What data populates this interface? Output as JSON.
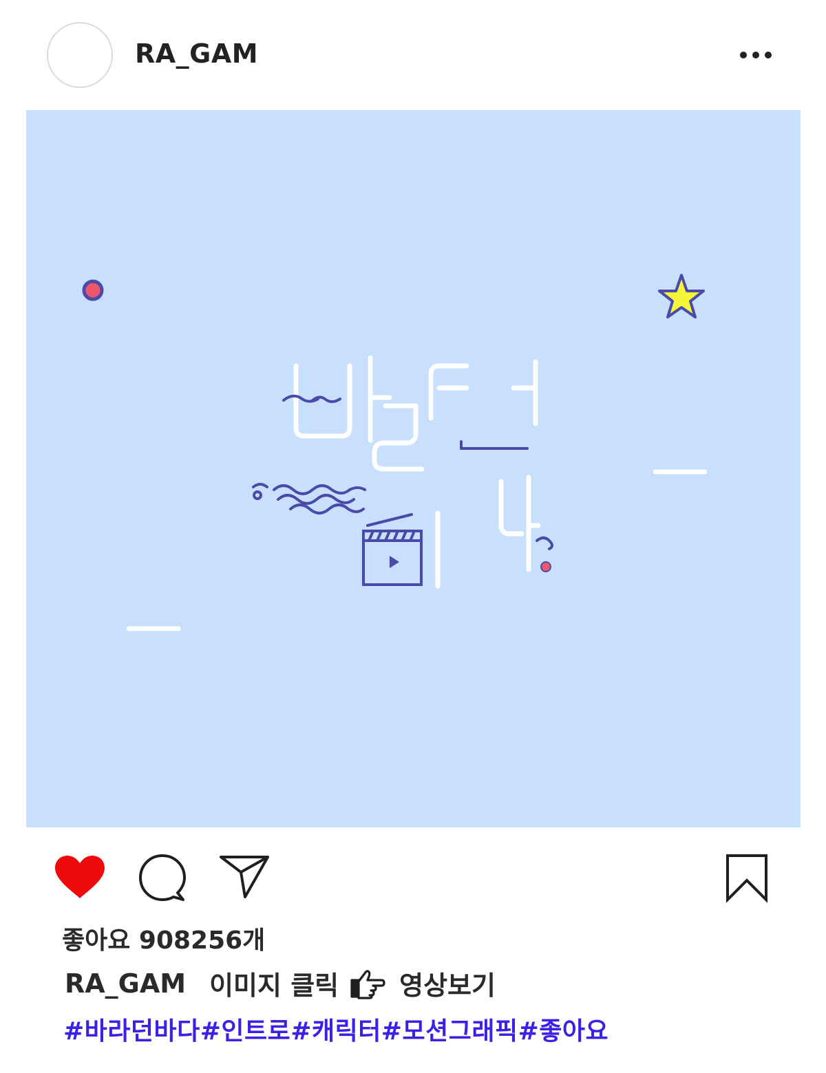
{
  "post": {
    "username": "RA_GAM",
    "likes_text": "좋아요 908256개",
    "caption_user": "RA_GAM",
    "caption_text_1": "이미지 클릭",
    "caption_text_2": "영상보기",
    "hashtags": "#바라던바다#인트로#캐릭터#모션그래픽#좋아요",
    "liked": true
  },
  "colors": {
    "image_bg": "#c8e0fd",
    "heart": "#ee0b0b",
    "hashtag": "#3b20e8",
    "accent_navy": "#4a4aa8",
    "dot_red": "#f0566b",
    "star_yellow": "#f5f53a"
  },
  "icons": {
    "more": "more-dots-icon",
    "like": "heart-icon",
    "comment": "comment-bubble-icon",
    "share": "paper-plane-icon",
    "save": "bookmark-icon",
    "caption_hand": "pointing-hand-icon"
  }
}
